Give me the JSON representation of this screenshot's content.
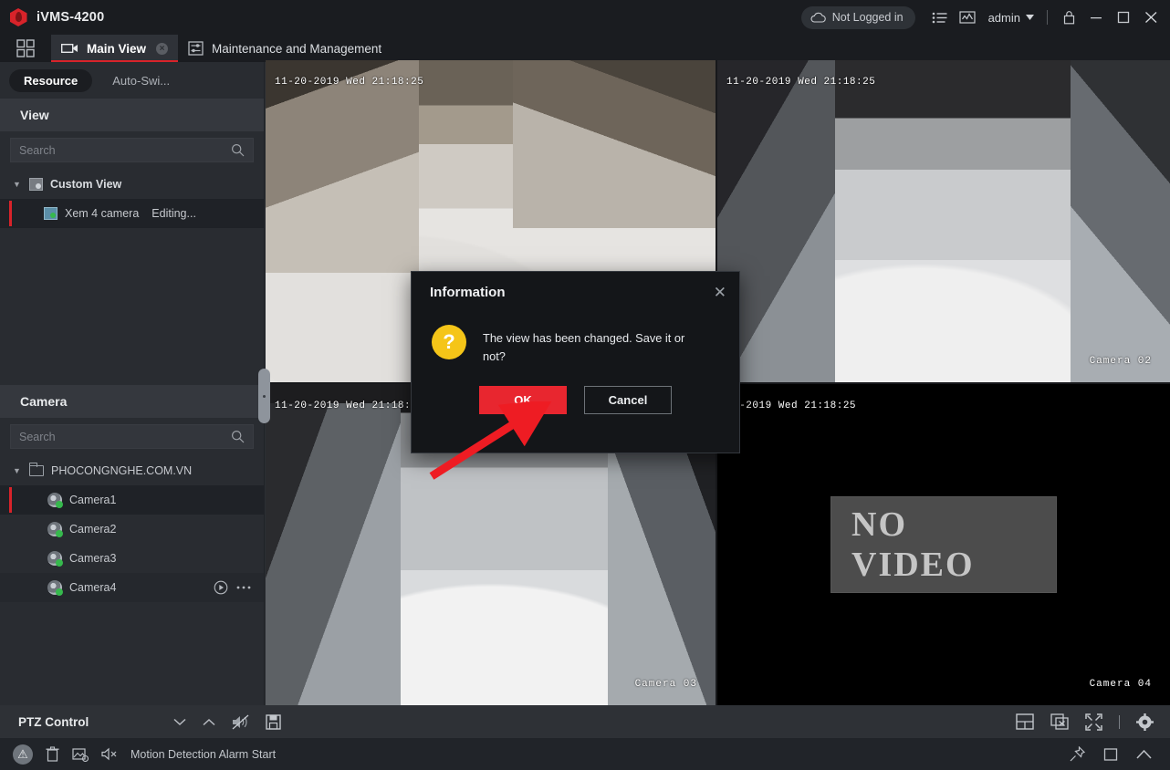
{
  "titlebar": {
    "app_name": "iVMS-4200",
    "cloud_status": "Not Logged in",
    "user": "admin",
    "icons": {
      "cloud": "cloud-icon",
      "list": "list-icon",
      "chart": "chart-icon",
      "caret": "chevron-down-icon",
      "lock": "lock-icon",
      "minimize": "minimize-icon",
      "maximize": "maximize-icon",
      "close": "close-icon"
    }
  },
  "tabbar": {
    "launcher": "grid-launcher-icon",
    "tabs": [
      {
        "label": "Main View",
        "icon": "camera-icon",
        "active": true,
        "closable": true,
        "close_glyph": "×"
      },
      {
        "label": "Maintenance and Management",
        "icon": "maintenance-icon",
        "active": false,
        "closable": false
      }
    ]
  },
  "leftpanel": {
    "segments": [
      {
        "label": "Resource",
        "active": true
      },
      {
        "label": "Auto-Swi...",
        "active": false
      }
    ],
    "view_section": {
      "header": "View",
      "search_placeholder": "Search",
      "tree": [
        {
          "label": "Custom View",
          "type": "group",
          "expanded": true,
          "caret": "▼"
        },
        {
          "label": "Xem 4 camera",
          "status": "Editing...",
          "type": "view",
          "selected": true
        }
      ]
    },
    "camera_section": {
      "header": "Camera",
      "search_placeholder": "Search",
      "tree": [
        {
          "label": "PHOCONGNGHE.COM.VN",
          "type": "group",
          "expanded": true,
          "caret": "▼"
        },
        {
          "label": "Camera1",
          "type": "camera",
          "selected": true
        },
        {
          "label": "Camera2",
          "type": "camera",
          "selected": false
        },
        {
          "label": "Camera3",
          "type": "camera",
          "selected": false
        },
        {
          "label": "Camera4",
          "type": "camera",
          "selected": false,
          "actions": [
            "play-icon",
            "more-icon"
          ]
        }
      ]
    }
  },
  "video_grid": {
    "panes": [
      {
        "timestamp": "11-20-2019 Wed 21:18:25",
        "camera_label": "",
        "state": "live"
      },
      {
        "timestamp": "11-20-2019 Wed 21:18:25",
        "camera_label": "Camera 02",
        "state": "live"
      },
      {
        "timestamp": "11-20-2019 Wed 21:18:25",
        "camera_label": "Camera 03",
        "state": "live"
      },
      {
        "timestamp": "20-2019 Wed 21:18:25",
        "camera_label": "Camera 04",
        "state": "no-video",
        "no_video_text": "NO VIDEO"
      }
    ]
  },
  "ptzbar": {
    "title": "PTZ Control",
    "left_icons": [
      "chevron-down-icon",
      "chevron-up-icon",
      "mute-icon",
      "save-icon"
    ],
    "right_icons": [
      "window-division-icon",
      "close-all-icon",
      "fullscreen-icon",
      "divider",
      "settings-icon"
    ]
  },
  "statusbar": {
    "alarm_glyph": "⚠",
    "icons": [
      "delete-icon",
      "picture-disabled-icon",
      "sound-off-icon"
    ],
    "message": "Motion Detection Alarm  Start",
    "right_icons": [
      "pin-icon",
      "window-icon",
      "chevron-up-icon"
    ]
  },
  "dialog": {
    "title": "Information",
    "close_glyph": "✕",
    "icon_glyph": "?",
    "message": "The view has been changed. Save it or not?",
    "ok_label": "OK",
    "cancel_label": "Cancel",
    "ok_color": "#e8262f"
  }
}
